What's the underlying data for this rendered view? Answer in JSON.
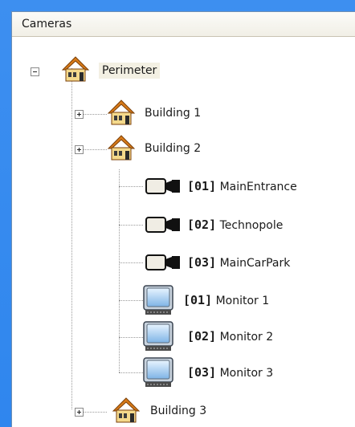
{
  "panel": {
    "header": "Cameras"
  },
  "tree": {
    "root": {
      "label": "Perimeter",
      "icon": "house-icon",
      "expanded": true
    },
    "buildings": [
      {
        "label": "Building 1",
        "icon": "house-icon"
      },
      {
        "label": "Building 2",
        "icon": "house-icon"
      }
    ],
    "cameras": [
      {
        "num": "[01]",
        "label": "MainEntrance",
        "icon": "camera-icon"
      },
      {
        "num": "[02]",
        "label": "Technopole",
        "icon": "camera-icon"
      },
      {
        "num": "[03]",
        "label": "MainCarPark",
        "icon": "camera-icon"
      }
    ],
    "monitors": [
      {
        "num": "[01]",
        "label": "Monitor 1",
        "icon": "monitor-icon"
      },
      {
        "num": "[02]",
        "label": "Monitor 2",
        "icon": "monitor-icon"
      },
      {
        "num": "[03]",
        "label": "Monitor 3",
        "icon": "monitor-icon"
      }
    ],
    "building3": {
      "label": "Building 3",
      "icon": "house-icon"
    }
  },
  "colors": {
    "background": "#2f86ee",
    "house_roof": "#d77a19",
    "house_body": "#f4d98b"
  }
}
